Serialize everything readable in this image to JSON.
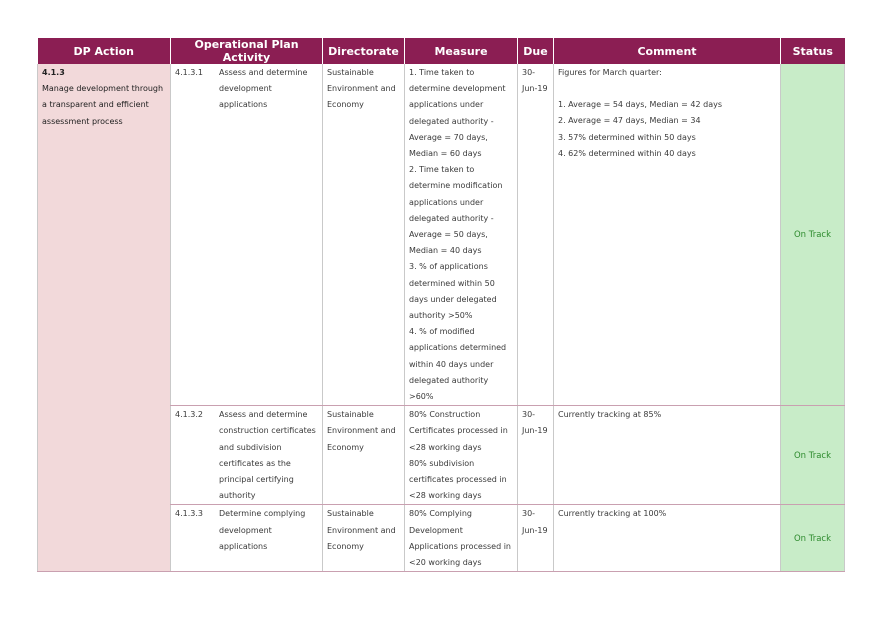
{
  "columns": [
    "DP Action",
    "Operational Plan Activity",
    "Directorate",
    "Measure",
    "Due",
    "Comment",
    "Status"
  ],
  "dp_action": {
    "code": "4.1.3",
    "text": "Manage development through a transparent and efficient assessment process"
  },
  "rows": [
    {
      "activity_num": "4.1.3.1",
      "activity_text": "Assess and determine development applications",
      "directorate": "Sustainable Environment and Economy",
      "measure": [
        "1. Time taken to determine development applications under delegated authority - Average = 70 days, Median = 60 days",
        "2. Time taken to determine modification applications under delegated authority - Average = 50 days, Median = 40 days",
        "3. % of applications determined within 50 days under delegated authority >50%",
        "4. % of modified applications determined within 40 days under delegated authority >60%"
      ],
      "due": "30-Jun-19",
      "comment_intro": "Figures for March quarter:",
      "comment_lines": [
        "1.  Average = 54 days, Median = 42 days",
        "2. Average = 47 days, Median = 34",
        "3. 57% determined within 50 days",
        "4. 62% determined within 40 days"
      ],
      "status": "On Track"
    },
    {
      "activity_num": "4.1.3.2",
      "activity_text": "Assess and determine construction certificates and subdivision certificates as the principal certifying authority",
      "directorate": "Sustainable Environment and Economy",
      "measure": [
        "80% Construction Certificates processed in <28 working days",
        "80% subdivision certificates  processed in <28 working days"
      ],
      "due": "30-Jun-19",
      "comment_intro": "Currently tracking at 85%",
      "comment_lines": [],
      "status": "On Track"
    },
    {
      "activity_num": "4.1.3.3",
      "activity_text": "Determine complying development applications",
      "directorate": "Sustainable Environment and Economy",
      "measure": [
        "80% Complying Development Applications processed in <20 working days"
      ],
      "due": "30-Jun-19",
      "comment_intro": "Currently tracking at 100%",
      "comment_lines": [],
      "status": "On Track"
    }
  ]
}
